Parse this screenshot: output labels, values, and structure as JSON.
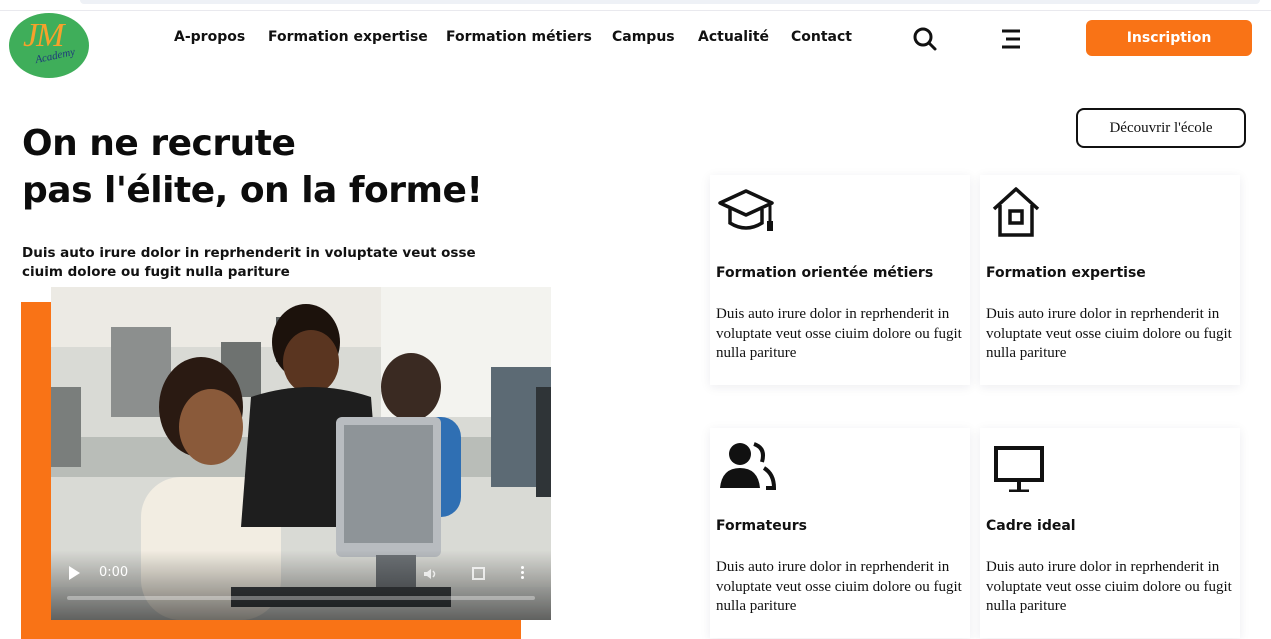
{
  "brand": {
    "logo_letters": "JM",
    "logo_subtext": "Academy",
    "colors": {
      "accent": "#f97316",
      "logo_green": "#3fae5a",
      "logo_gold": "#f7a12b"
    }
  },
  "nav": {
    "items": [
      {
        "label": "A-propos"
      },
      {
        "label": "Formation expertise"
      },
      {
        "label": "Formation métiers"
      },
      {
        "label": "Campus"
      },
      {
        "label": "Actualité"
      },
      {
        "label": "Contact"
      }
    ],
    "search_icon": "search-icon",
    "menu_icon": "menu-icon",
    "cta_label": "Inscription"
  },
  "hero": {
    "title_line1": "On ne recrute",
    "title_line2": "pas l'élite, on la forme!",
    "subtitle": "Duis auto irure dolor in reprhenderit in voluptate veut osse ciuim dolore ou fugit nulla pariture",
    "discover_label": "Découvrir l'école"
  },
  "video": {
    "current_time": "0:00",
    "progress": 0
  },
  "features": [
    {
      "icon": "graduation-cap-icon",
      "title": "Formation orientée métiers",
      "text": "Duis auto irure dolor in reprhenderit in voluptate veut osse ciuim dolore ou fugit nulla pariture"
    },
    {
      "icon": "house-icon",
      "title": "Formation expertise",
      "text": "Duis auto irure dolor in reprhenderit in voluptate veut osse ciuim dolore ou fugit nulla pariture"
    },
    {
      "icon": "users-icon",
      "title": "Formateurs",
      "text": "Duis auto irure dolor in reprhenderit in voluptate veut osse ciuim dolore ou fugit nulla pariture"
    },
    {
      "icon": "monitor-icon",
      "title": "Cadre ideal",
      "text": "Duis auto irure dolor in reprhenderit in voluptate veut osse ciuim dolore ou fugit nulla pariture"
    }
  ]
}
